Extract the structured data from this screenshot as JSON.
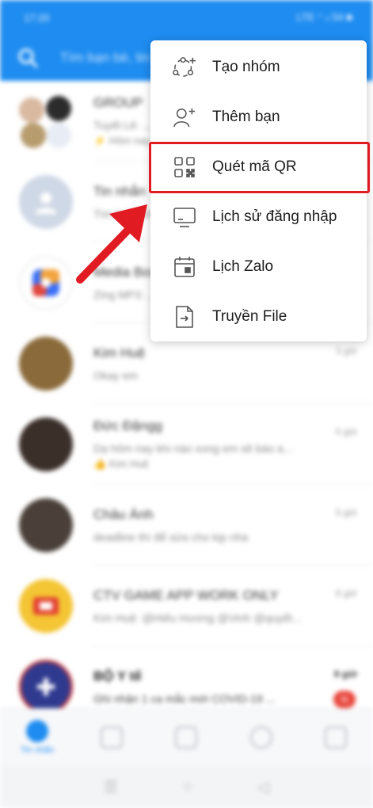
{
  "status_bar": {
    "time": "17:20",
    "indicators": "LTE ⁺ ᵢₗ 54 ■"
  },
  "app_bar": {
    "search_placeholder": "Tìm bạn bè, tin nhắn..."
  },
  "chats": [
    {
      "name": "GROUP",
      "preview": "Tuyết Lê: ...",
      "sub": "⚡ Hôm nay",
      "time": "",
      "avatar_color": "#d9c7b8",
      "badge": ""
    },
    {
      "name": "Tin nhắn",
      "preview": "Tìm kiếm nhanh ...",
      "sub": "",
      "time": "",
      "avatar_color": "#cfd8e6",
      "badge": ""
    },
    {
      "name": "Media Box",
      "preview": "Zing MP3: ...",
      "sub": "",
      "time": "",
      "avatar_color": "#ffffff",
      "badge": ""
    },
    {
      "name": "Kim Huệ",
      "preview": "Okay em",
      "sub": "",
      "time": "3 giờ",
      "avatar_color": "#8a6a3a",
      "badge": ""
    },
    {
      "name": "Đức Đặngg",
      "preview": "Dạ hôm nay khi nào xong em sẽ báo a...",
      "sub": "👍 Kim Huệ",
      "time": "5 giờ",
      "avatar_color": "#3b2f2a",
      "badge": ""
    },
    {
      "name": "Châu Ánh",
      "preview": "deadline thì để sửa cho kịp nha",
      "sub": "",
      "time": "5 giờ",
      "avatar_color": "#4a4039",
      "badge": ""
    },
    {
      "name": "CTV GAME APP WORK ONLY",
      "preview": "Kim Huệ: @Hiếu Hương @Vinh @quyết...",
      "sub": "",
      "time": "6 giờ",
      "avatar_color": "#f4c534",
      "badge": ""
    },
    {
      "name": "BỘ Y tế",
      "preview": "Ghi nhận 1 ca mắc mới COVID-19 ...",
      "sub": "",
      "time": "9 giờ",
      "avatar_color": "#2f3a8f",
      "badge": "N"
    }
  ],
  "bottom_nav": {
    "active_label": "Tin nhắn"
  },
  "menu": {
    "items": [
      {
        "label": "Tạo nhóm",
        "icon": "create-group-icon"
      },
      {
        "label": "Thêm bạn",
        "icon": "add-friend-icon"
      },
      {
        "label": "Quét mã QR",
        "icon": "qr-scan-icon"
      },
      {
        "label": "Lịch sử đăng nhập",
        "icon": "login-history-icon"
      },
      {
        "label": "Lịch Zalo",
        "icon": "calendar-icon"
      },
      {
        "label": "Truyền File",
        "icon": "file-transfer-icon"
      }
    ]
  },
  "annotation": {
    "highlight_color": "#e11b22",
    "highlighted_item": "Quét mã QR"
  },
  "colors": {
    "brand": "#1e8cf0",
    "badge": "#e8463b"
  }
}
